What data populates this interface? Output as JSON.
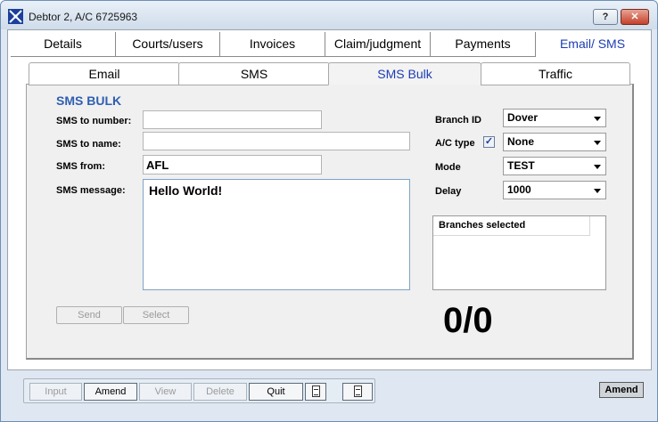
{
  "window": {
    "title": "Debtor 2, A/C 6725963",
    "help_label": "?",
    "close_label": "✕"
  },
  "top_tabs": [
    {
      "label": "Details"
    },
    {
      "label": "Courts/users"
    },
    {
      "label": "Invoices"
    },
    {
      "label": "Claim/judgment"
    },
    {
      "label": "Payments"
    },
    {
      "label": "Email/ SMS"
    }
  ],
  "sub_tabs": [
    {
      "label": "Email"
    },
    {
      "label": "SMS"
    },
    {
      "label": "SMS Bulk"
    },
    {
      "label": "Traffic"
    }
  ],
  "sms_bulk": {
    "section_title": "SMS BULK",
    "to_number": {
      "label": "SMS to number:",
      "value": ""
    },
    "to_name": {
      "label": "SMS to name:",
      "value": ""
    },
    "from": {
      "label": "SMS from:",
      "value": "AFL"
    },
    "message": {
      "label": "SMS message:",
      "value": "Hello World!"
    },
    "send_label": "Send",
    "select_label": "Select"
  },
  "options": {
    "branch_id": {
      "label": "Branch ID",
      "selected": "Dover"
    },
    "ac_type": {
      "label": "A/C type",
      "checked": "✓",
      "selected": "None"
    },
    "mode": {
      "label": "Mode",
      "selected": "TEST"
    },
    "delay": {
      "label": "Delay",
      "selected": "1000"
    }
  },
  "branches": {
    "header": "Branches selected",
    "items": []
  },
  "counter": "0/0",
  "toolbar": {
    "input_label": "Input",
    "amend_label": "Amend",
    "view_label": "View",
    "delete_label": "Delete",
    "quit_label": "Quit"
  },
  "status_badge": "Amend"
}
